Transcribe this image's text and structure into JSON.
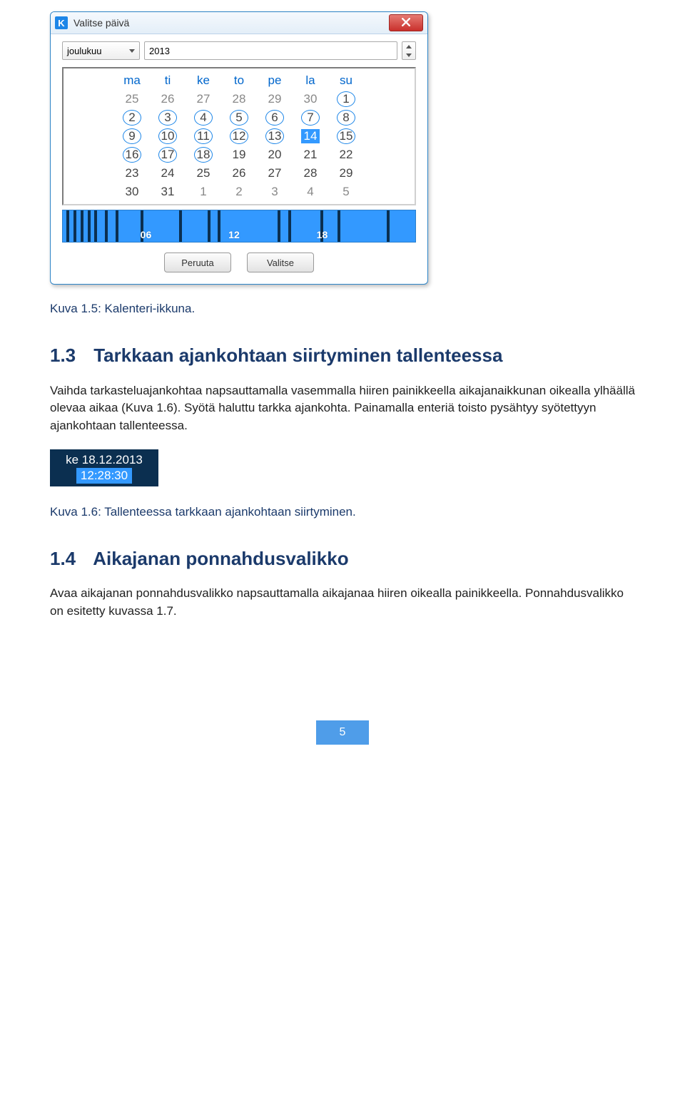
{
  "calendar_dialog": {
    "app_icon_letter": "K",
    "title": "Valitse päivä",
    "month_label": "joulukuu",
    "year_value": "2013",
    "weekday_headers": [
      "ma",
      "ti",
      "ke",
      "to",
      "pe",
      "la",
      "su"
    ],
    "rows": [
      [
        {
          "n": "25",
          "muted": true
        },
        {
          "n": "26",
          "muted": true
        },
        {
          "n": "27",
          "muted": true
        },
        {
          "n": "28",
          "muted": true
        },
        {
          "n": "29",
          "muted": true
        },
        {
          "n": "30",
          "muted": true
        },
        {
          "n": "1",
          "circled": true
        }
      ],
      [
        {
          "n": "2",
          "circled": true
        },
        {
          "n": "3",
          "circled": true
        },
        {
          "n": "4",
          "circled": true
        },
        {
          "n": "5",
          "circled": true
        },
        {
          "n": "6",
          "circled": true
        },
        {
          "n": "7",
          "circled": true
        },
        {
          "n": "8",
          "circled": true
        }
      ],
      [
        {
          "n": "9",
          "circled": true
        },
        {
          "n": "10",
          "circled": true
        },
        {
          "n": "11",
          "circled": true
        },
        {
          "n": "12",
          "circled": true
        },
        {
          "n": "13",
          "circled": true
        },
        {
          "n": "14",
          "selected": true
        },
        {
          "n": "15",
          "circled": true
        }
      ],
      [
        {
          "n": "16",
          "circled": true
        },
        {
          "n": "17",
          "circled": true
        },
        {
          "n": "18",
          "circled": true
        },
        {
          "n": "19"
        },
        {
          "n": "20"
        },
        {
          "n": "21"
        },
        {
          "n": "22"
        }
      ],
      [
        {
          "n": "23"
        },
        {
          "n": "24"
        },
        {
          "n": "25"
        },
        {
          "n": "26"
        },
        {
          "n": "27"
        },
        {
          "n": "28"
        },
        {
          "n": "29"
        }
      ],
      [
        {
          "n": "30"
        },
        {
          "n": "31"
        },
        {
          "n": "1",
          "muted": true
        },
        {
          "n": "2",
          "muted": true
        },
        {
          "n": "3",
          "muted": true
        },
        {
          "n": "4",
          "muted": true
        },
        {
          "n": "5",
          "muted": true
        }
      ]
    ],
    "timeline_hours": [
      "06",
      "12",
      "18"
    ],
    "timeline_bars_pct": [
      1,
      3,
      5,
      7,
      9,
      12,
      15,
      22,
      33,
      41,
      44,
      61,
      64,
      73,
      78,
      92
    ],
    "cancel_label": "Peruuta",
    "select_label": "Valitse"
  },
  "caption_1_5": "Kuva 1.5: Kalenteri-ikkuna.",
  "sect_1_3": {
    "num": "1.3",
    "title": "Tarkkaan ajankohtaan siirtyminen tallenteessa"
  },
  "para_1_3": "Vaihda tarkasteluajankohtaa napsauttamalla vasemmalla hiiren painikkeella aikajanaikkunan oikealla ylhäällä olevaa aikaa (Kuva 1.6). Syötä haluttu tarkka ajankohta. Painamalla enteriä toisto pysähtyy syötettyyn ajankohtaan tallenteessa.",
  "mini_img": {
    "line1": "ke 18.12.2013",
    "line2": "12:28:30"
  },
  "caption_1_6": "Kuva 1.6: Tallenteessa tarkkaan ajankohtaan siirtyminen.",
  "sect_1_4": {
    "num": "1.4",
    "title": "Aikajanan ponnahdusvalikko"
  },
  "para_1_4": "Avaa aikajanan ponnahdusvalikko napsauttamalla aikajanaa hiiren oikealla painikkeella. Ponnahdusvalikko on esitetty kuvassa 1.7.",
  "page_number": "5"
}
